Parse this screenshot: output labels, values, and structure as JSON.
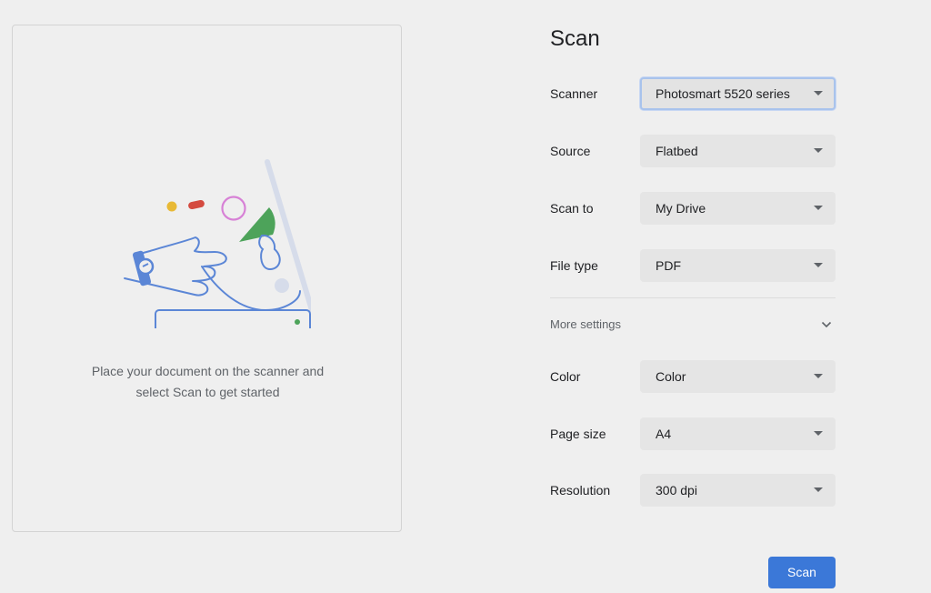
{
  "preview": {
    "hint_line1": "Place your document on the scanner and",
    "hint_line2": "select Scan to get started"
  },
  "panel": {
    "title": "Scan",
    "settings": [
      {
        "label": "Scanner",
        "value": "Photosmart 5520 series"
      },
      {
        "label": "Source",
        "value": "Flatbed"
      },
      {
        "label": "Scan to",
        "value": "My Drive"
      },
      {
        "label": "File type",
        "value": "PDF"
      }
    ],
    "more_settings_label": "More settings",
    "more_settings": [
      {
        "label": "Color",
        "value": "Color"
      },
      {
        "label": "Page size",
        "value": "A4"
      },
      {
        "label": "Resolution",
        "value": "300 dpi"
      }
    ],
    "scan_button_label": "Scan"
  },
  "colors": {
    "accent": "#3b78d8",
    "background": "#efefef",
    "illustration_blue": "#5b86d6",
    "illustration_green": "#4da35a",
    "illustration_red": "#d44a3f",
    "illustration_yellow": "#e8b935",
    "illustration_pink": "#d781d6"
  },
  "icons": {
    "dropdown": "caret-down-icon",
    "expand": "chevron-down-icon"
  }
}
